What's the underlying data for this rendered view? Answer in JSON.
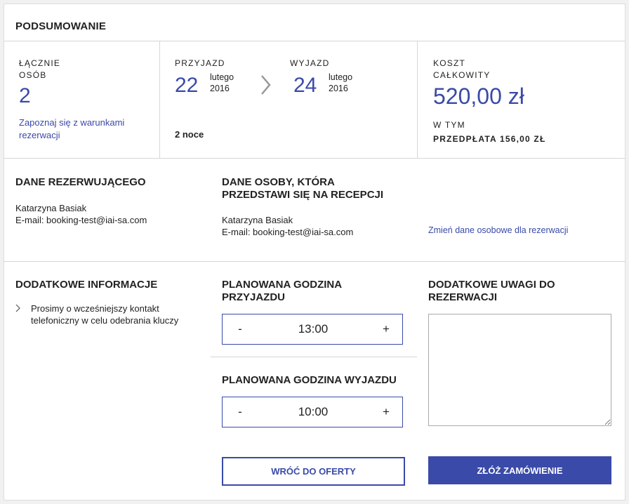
{
  "summary": {
    "title": "PODSUMOWANIE",
    "guests_label_line1": "ŁĄCZNIE",
    "guests_label_line2": "OSÓB",
    "guests_count": "2",
    "terms_link_line1": "Zapoznaj się z warunkami",
    "terms_link_line2": "rezerwacji",
    "arrival_label": "PRZYJAZD",
    "arrival_day": "22",
    "arrival_month": "lutego",
    "arrival_year": "2016",
    "departure_label": "WYJAZD",
    "departure_day": "24",
    "departure_month": "lutego",
    "departure_year": "2016",
    "nights": "2 noce",
    "cost_label_line1": "KOSZT",
    "cost_label_line2": "CAŁKOWITY",
    "cost_value": "520,00 zł",
    "included_label": "W TYM",
    "prepayment": "PRZEDPŁATA 156,00 ZŁ"
  },
  "booker": {
    "title": "DANE REZERWUJĄCEGO",
    "name": "Katarzyna Basiak",
    "email": "E-mail: booking-test@iai-sa.com"
  },
  "guest": {
    "title_line1": "DANE OSOBY, KTÓRA",
    "title_line2": "PRZEDSTAWI SIĘ NA RECEPCJI",
    "name": "Katarzyna Basiak",
    "email": "E-mail: booking-test@iai-sa.com",
    "change_link": "Zmień dane osobowe dla rezerwacji"
  },
  "extra_info": {
    "title": "DODATKOWE INFORMACJE",
    "items": [
      "Prosimy o wcześniejszy kontakt",
      "telefoniczny w celu odebrania kluczy"
    ]
  },
  "arrival_time": {
    "title_line1": "PLANOWANA GODZINA",
    "title_line2": "PRZYJAZDU",
    "minus": "-",
    "value": "13:00",
    "plus": "+"
  },
  "departure_time": {
    "title": "PLANOWANA GODZINA WYJAZDU",
    "minus": "-",
    "value": "10:00",
    "plus": "+"
  },
  "notes": {
    "title_line1": "DODATKOWE UWAGI DO",
    "title_line2": "REZERWACJI",
    "value": ""
  },
  "actions": {
    "back_label": "WRÓĆ DO OFERTY",
    "submit_label": "ZŁÓŻ ZAMÓWIENIE"
  },
  "colors": {
    "accent": "#3a4aa8",
    "border": "#d6d6d6"
  },
  "icons": {
    "date_separator": "chevron-right-icon",
    "list_bullet": "chevron-right-icon"
  }
}
